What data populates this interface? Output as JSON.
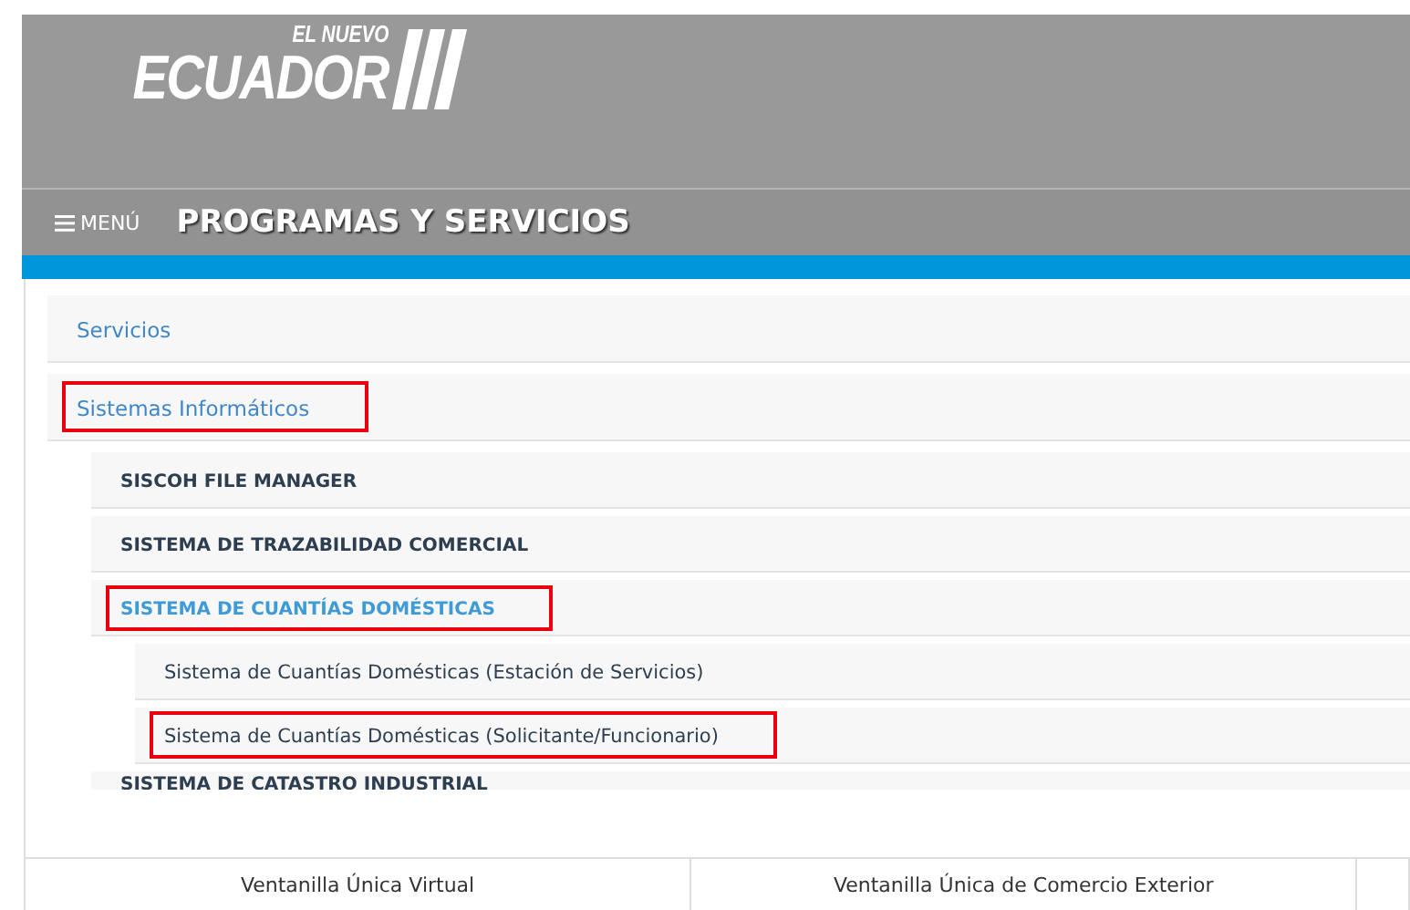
{
  "header": {
    "logo_small": "EL NUEVO",
    "logo_large": "ECUADOR"
  },
  "menu_bar": {
    "menu_button": "MENÚ",
    "title": "PROGRAMAS Y SERVICIOS"
  },
  "tree": [
    {
      "label": "Servicios",
      "kind": "section",
      "highlighted": false
    },
    {
      "label": "Sistemas Informáticos",
      "kind": "section",
      "highlighted": true,
      "children": [
        {
          "label": "SISCOH FILE MANAGER",
          "kind": "system",
          "highlighted": false
        },
        {
          "label": "SISTEMA DE TRAZABILIDAD COMERCIAL",
          "kind": "system",
          "highlighted": false
        },
        {
          "label": "SISTEMA DE CUANTÍAS DOMÉSTICAS",
          "kind": "system",
          "highlighted": true,
          "children": [
            {
              "label": "Sistema de Cuantías Domésticas (Estación de Servicios)",
              "kind": "link",
              "highlighted": false
            },
            {
              "label": "Sistema de Cuantías Domésticas (Solicitante/Funcionario)",
              "kind": "link",
              "highlighted": true
            }
          ]
        },
        {
          "label": "SISTEMA DE CATASTRO INDUSTRIAL",
          "kind": "system",
          "highlighted": false
        }
      ]
    }
  ],
  "footer_links": [
    "Ventanilla Única Virtual",
    "Ventanilla Única de Comercio Exterior"
  ]
}
